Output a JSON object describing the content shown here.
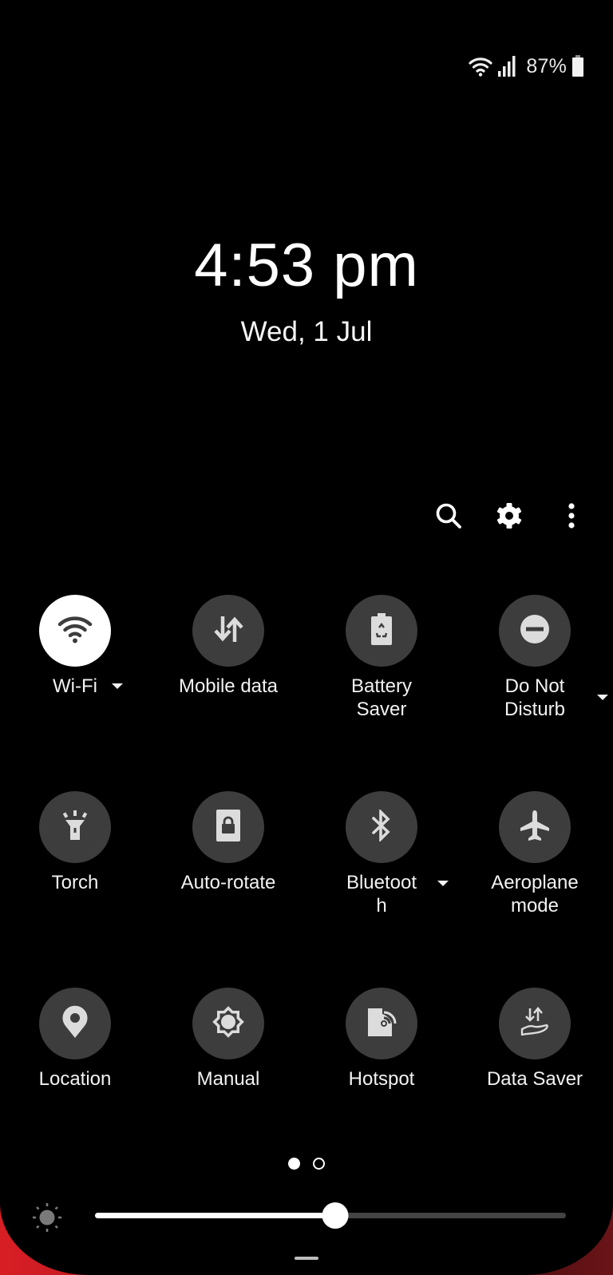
{
  "status_bar": {
    "battery_percent": "87%",
    "icons": [
      "wifi-icon",
      "cellular-signal-icon",
      "battery-icon"
    ]
  },
  "clock": {
    "time": "4:53 pm",
    "date": "Wed, 1 Jul"
  },
  "toolbar": {
    "icons": [
      "search-icon",
      "settings-gear-icon",
      "more-options-icon"
    ]
  },
  "tiles": [
    {
      "label": "Wi-Fi",
      "icon": "wifi-icon",
      "state": "on",
      "has_dropdown": true
    },
    {
      "label": "Mobile data",
      "icon": "mobile-data-icon",
      "state": "off",
      "has_dropdown": false
    },
    {
      "label": "Battery Saver",
      "icon": "battery-saver-icon",
      "state": "off",
      "has_dropdown": false
    },
    {
      "label": "Do Not Disturb",
      "icon": "do-not-disturb-icon",
      "state": "off",
      "has_dropdown": true
    },
    {
      "label": "Torch",
      "icon": "torch-icon",
      "state": "off",
      "has_dropdown": false
    },
    {
      "label": "Auto-rotate",
      "icon": "auto-rotate-lock-icon",
      "state": "off",
      "has_dropdown": false
    },
    {
      "label": "Bluetooth",
      "icon": "bluetooth-icon",
      "state": "off",
      "has_dropdown": true
    },
    {
      "label": "Aeroplane mode",
      "icon": "aeroplane-icon",
      "state": "off",
      "has_dropdown": false
    },
    {
      "label": "Location",
      "icon": "location-pin-icon",
      "state": "off",
      "has_dropdown": false
    },
    {
      "label": "Manual",
      "icon": "brightness-manual-icon",
      "state": "off",
      "has_dropdown": false
    },
    {
      "label": "Hotspot",
      "icon": "hotspot-icon",
      "state": "off",
      "has_dropdown": false
    },
    {
      "label": "Data Saver",
      "icon": "data-saver-icon",
      "state": "off",
      "has_dropdown": false
    }
  ],
  "tile_labels_display": {
    "t0": "Wi-Fi",
    "t1": "Mobile data",
    "t2a": "Battery",
    "t2b": "Saver",
    "t3a": "Do Not",
    "t3b": "Disturb",
    "t4": "Torch",
    "t5": "Auto-rotate",
    "t6a": "Bluetoot",
    "t6b": "h",
    "t7a": "Aeroplane",
    "t7b": "mode",
    "t8": "Location",
    "t9": "Manual",
    "t10": "Hotspot",
    "t11": "Data Saver"
  },
  "pager": {
    "current_page": 1,
    "total_pages": 2
  },
  "brightness": {
    "level_percent": 51
  },
  "colors": {
    "tile_off": "#3d3d3d",
    "tile_on": "#ffffff",
    "icon_off": "#dcdcdc",
    "icon_on": "#3d3d3d",
    "slider_fill": "#ffffff",
    "slider_track": "#444444",
    "wallpaper_accent": "#d81e25"
  }
}
